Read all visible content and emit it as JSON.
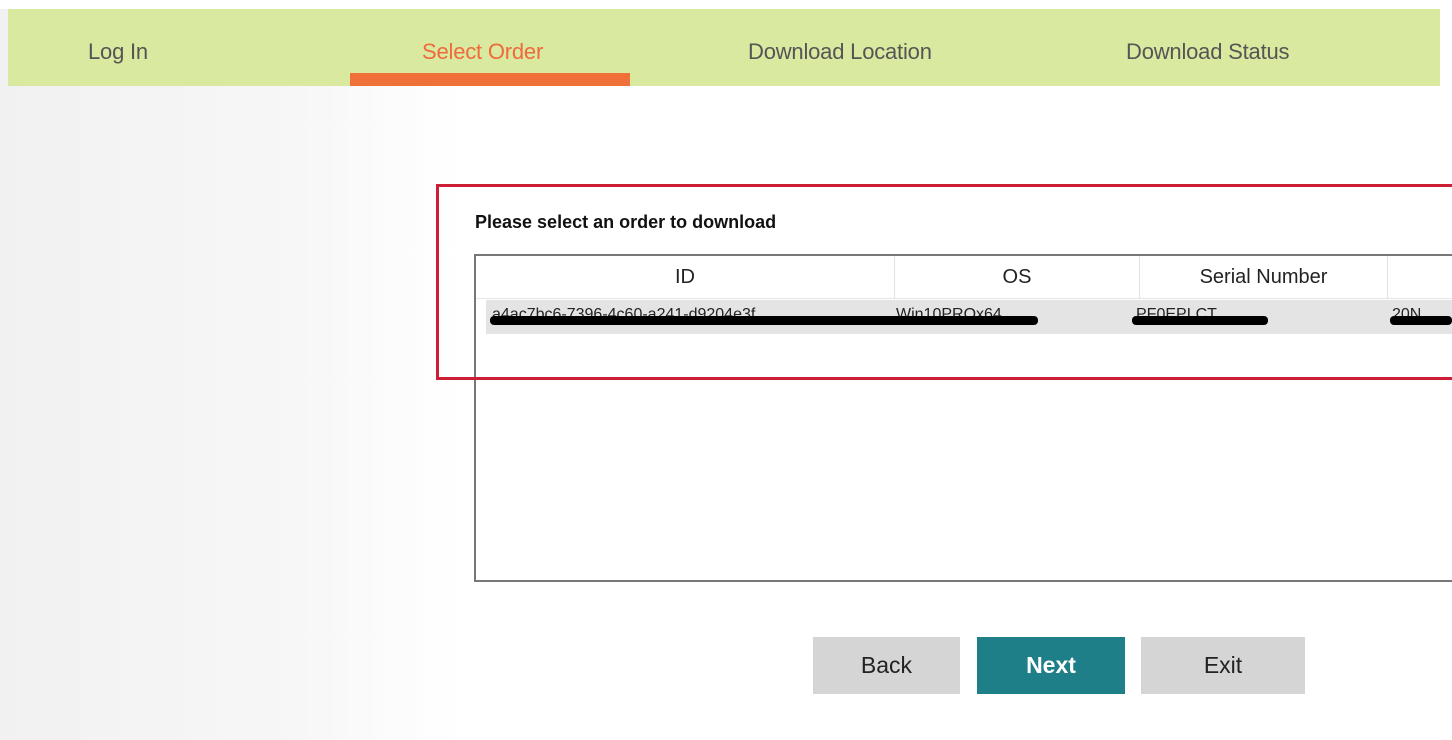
{
  "steps": {
    "items": [
      {
        "label": "Log In",
        "active": false
      },
      {
        "label": "Select Order",
        "active": true
      },
      {
        "label": "Download Location",
        "active": false
      },
      {
        "label": "Download Status",
        "active": false
      }
    ]
  },
  "order_panel": {
    "prompt": "Please select an order to download",
    "columns": [
      "ID",
      "OS",
      "Serial Number",
      ""
    ],
    "rows": [
      {
        "id": "a4ac7bc6-7396-4c60-a241-d9204e3f",
        "os": "Win10PROx64",
        "serial": "PF0EPLCT",
        "extra": "20N"
      }
    ]
  },
  "buttons": {
    "back": "Back",
    "next": "Next",
    "exit": "Exit"
  },
  "colors": {
    "step_bar": "#d9e9a0",
    "active_step": "#ef6a3c",
    "highlight_border": "#cc1f35",
    "next_button": "#1f7f88",
    "secondary_button": "#d5d5d5"
  }
}
